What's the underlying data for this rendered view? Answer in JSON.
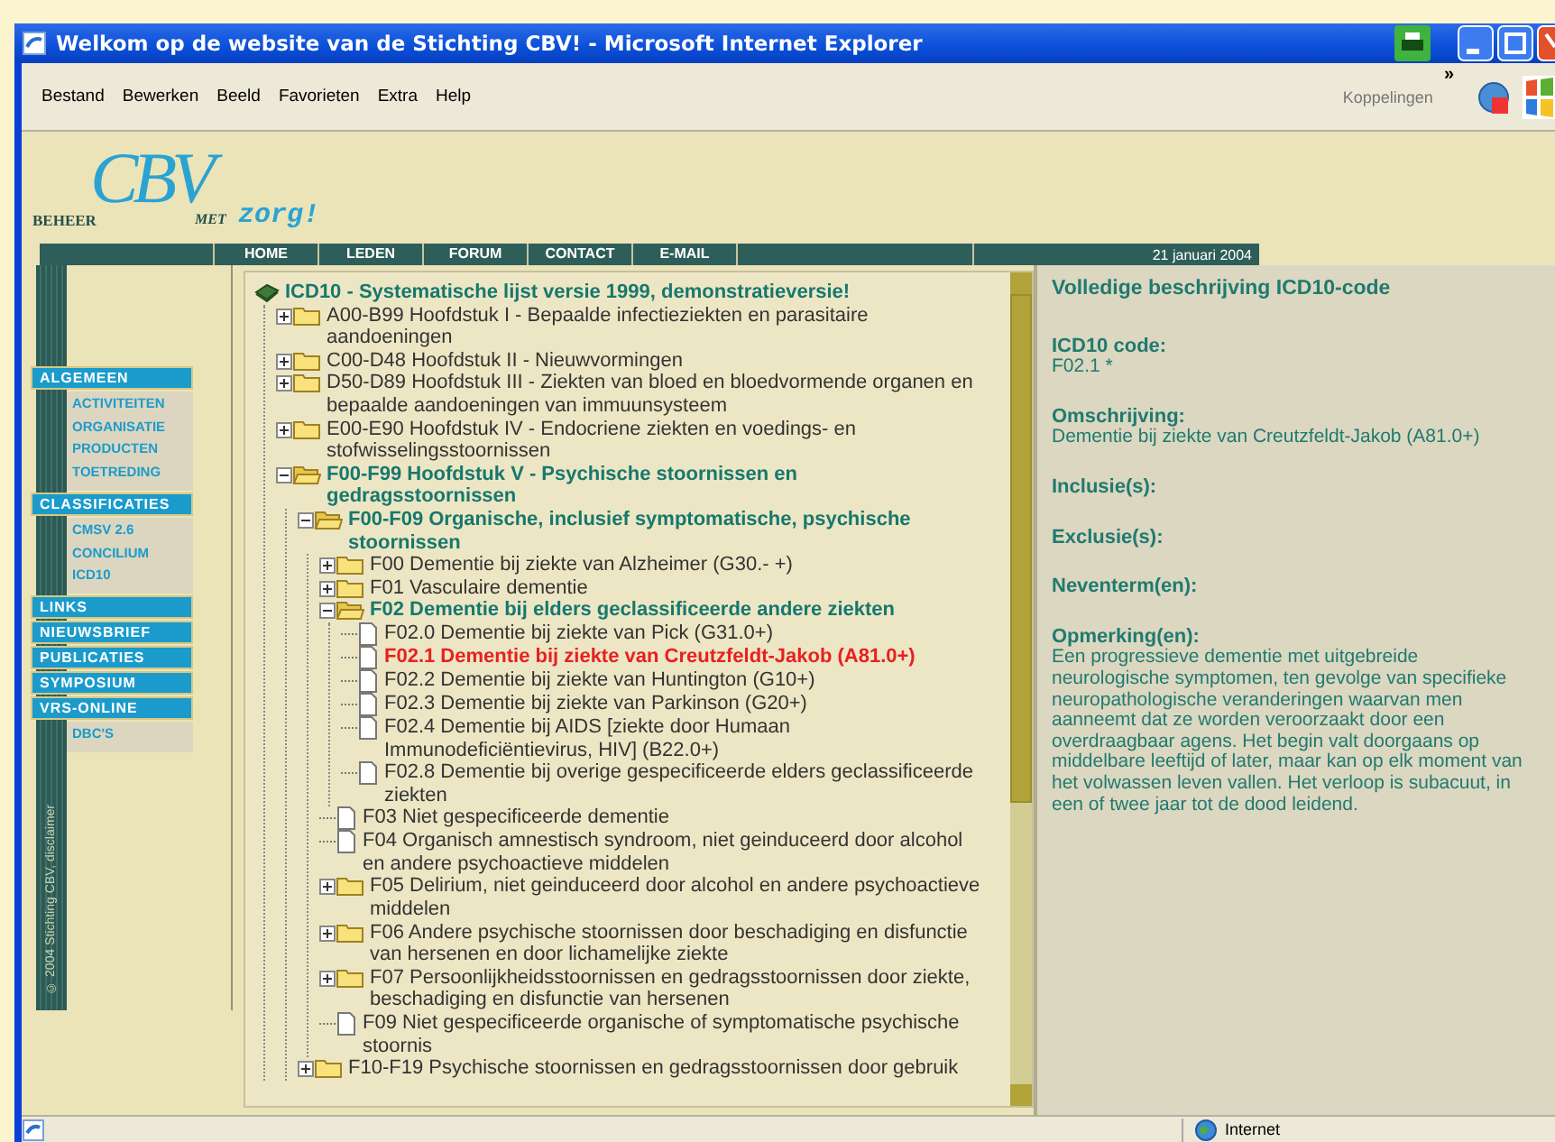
{
  "window": {
    "title": "Welkom op de website van de Stichting CBV! - Microsoft Internet Explorer"
  },
  "menu_bar": {
    "items": [
      "Bestand",
      "Bewerken",
      "Beeld",
      "Favorieten",
      "Extra",
      "Help"
    ],
    "links_label": "Koppelingen",
    "chevron": "»"
  },
  "logo": {
    "letters": "CBV",
    "left_word": "BEHEER",
    "middle_word": "MET",
    "tagline": "zorg!"
  },
  "nav": {
    "items": [
      "HOME",
      "LEDEN",
      "FORUM",
      "CONTACT",
      "E-MAIL"
    ],
    "date": "21 januari 2004"
  },
  "copyright": "© 2004 Stichting CBV, disclaimer",
  "sidebar": {
    "sections": [
      {
        "label": "ALGEMEEN",
        "children": [
          "ACTIVITEITEN",
          "ORGANISATIE",
          "PRODUCTEN",
          "TOETREDING"
        ]
      },
      {
        "label": "CLASSIFICATIES",
        "children": [
          "CMSV 2.6",
          "CONCILIUM",
          "ICD10"
        ]
      },
      {
        "label": "LINKS"
      },
      {
        "label": "NIEUWSBRIEF"
      },
      {
        "label": "PUBLICATIES"
      },
      {
        "label": "SYMPOSIUM"
      },
      {
        "label": "VRS-ONLINE",
        "children": [
          "DBC'S"
        ]
      }
    ]
  },
  "tree": {
    "kind": "root",
    "label": "ICD10 - Systematische lijst versie 1999, demonstratieversie!",
    "selected": false,
    "children": [
      {
        "kind": "folder",
        "label": "A00-B99 Hoofdstuk I - Bepaalde infectieziekten en parasitaire aandoeningen",
        "expanded": false,
        "selected": false
      },
      {
        "kind": "folder",
        "label": "C00-D48 Hoofdstuk II - Nieuwvormingen",
        "expanded": false,
        "selected": false
      },
      {
        "kind": "folder",
        "label": "D50-D89 Hoofdstuk III - Ziekten van bloed en bloedvormende organen en bepaalde aandoeningen van immuunsysteem",
        "expanded": false,
        "selected": false
      },
      {
        "kind": "folder",
        "label": "E00-E90 Hoofdstuk IV - Endocriene ziekten en voedings- en stofwisselingsstoornissen",
        "expanded": false,
        "selected": false
      },
      {
        "kind": "folder",
        "label": "F00-F99 Hoofdstuk V - Psychische stoornissen en gedragsstoornissen",
        "expanded": true,
        "selected": false,
        "children": [
          {
            "kind": "folder",
            "label": "F00-F09 Organische, inclusief symptomatische, psychische stoornissen",
            "expanded": true,
            "selected": false,
            "children": [
              {
                "kind": "folder",
                "label": "F00 Dementie bij ziekte van Alzheimer (G30.- +)",
                "expanded": false,
                "selected": false
              },
              {
                "kind": "folder",
                "label": "F01 Vasculaire dementie",
                "expanded": false,
                "selected": false
              },
              {
                "kind": "folder",
                "label": "F02 Dementie bij elders geclassificeerde andere ziekten",
                "expanded": true,
                "selected": false,
                "children": [
                  {
                    "kind": "page",
                    "label": "F02.0 Dementie bij ziekte van Pick (G31.0+)",
                    "selected": false
                  },
                  {
                    "kind": "page",
                    "label": "F02.1 Dementie bij ziekte van Creutzfeldt-Jakob (A81.0+)",
                    "selected": true
                  },
                  {
                    "kind": "page",
                    "label": "F02.2 Dementie bij ziekte van Huntington (G10+)",
                    "selected": false
                  },
                  {
                    "kind": "page",
                    "label": "F02.3 Dementie bij ziekte van Parkinson (G20+)",
                    "selected": false
                  },
                  {
                    "kind": "page",
                    "label": "F02.4 Dementie bij AIDS [ziekte door Humaan Immunodeficiëntievirus, HIV] (B22.0+)",
                    "selected": false
                  },
                  {
                    "kind": "page",
                    "label": "F02.8 Dementie bij overige gespecificeerde elders geclassificeerde ziekten",
                    "selected": false
                  }
                ]
              },
              {
                "kind": "page",
                "label": "F03 Niet gespecificeerde dementie",
                "selected": false
              },
              {
                "kind": "page",
                "label": "F04 Organisch amnestisch syndroom, niet geinduceerd door alcohol en andere psychoactieve middelen",
                "selected": false
              },
              {
                "kind": "folder",
                "label": "F05 Delirium, niet geinduceerd door alcohol en andere psychoactieve middelen",
                "expanded": false,
                "selected": false
              },
              {
                "kind": "folder",
                "label": "F06 Andere psychische stoornissen door beschadiging en disfunctie van hersenen en door lichamelijke ziekte",
                "expanded": false,
                "selected": false
              },
              {
                "kind": "folder",
                "label": "F07 Persoonlijkheidsstoornissen en gedragsstoornissen door ziekte, beschadiging en disfunctie van hersenen",
                "expanded": false,
                "selected": false
              },
              {
                "kind": "page",
                "label": "F09 Niet gespecificeerde organische of symptomatische psychische stoornis",
                "selected": false
              }
            ]
          },
          {
            "kind": "folder",
            "label": "F10-F19 Psychische stoornissen en gedragsstoornissen door gebruik",
            "expanded": false,
            "selected": false
          }
        ]
      }
    ]
  },
  "detail": {
    "title": "Volledige beschrijving ICD10-code",
    "fields": [
      {
        "label": "ICD10 code:",
        "value": "F02.1 *"
      },
      {
        "label": "Omschrijving:",
        "value": "Dementie bij ziekte van Creutzfeldt-Jakob (A81.0+)"
      },
      {
        "label": "Inclusie(s):"
      },
      {
        "label": "Exclusie(s):"
      },
      {
        "label": "Neventerm(en):"
      },
      {
        "label": "Opmerking(en):",
        "value": "Een progressieve dementie met uitgebreide neurologische symptomen, ten gevolge van specifieke neuropathologische veranderingen waarvan men aanneemt dat ze worden veroorzaakt door een overdraagbaar agens. Het begin valt doorgaans op middelbare leeftijd of later, maar kan op elk moment van het volwassen leven vallen. Het verloop is subacuut, in een of twee jaar tot de dood leidend."
      }
    ]
  },
  "status_bar": {
    "zone": "Internet"
  }
}
